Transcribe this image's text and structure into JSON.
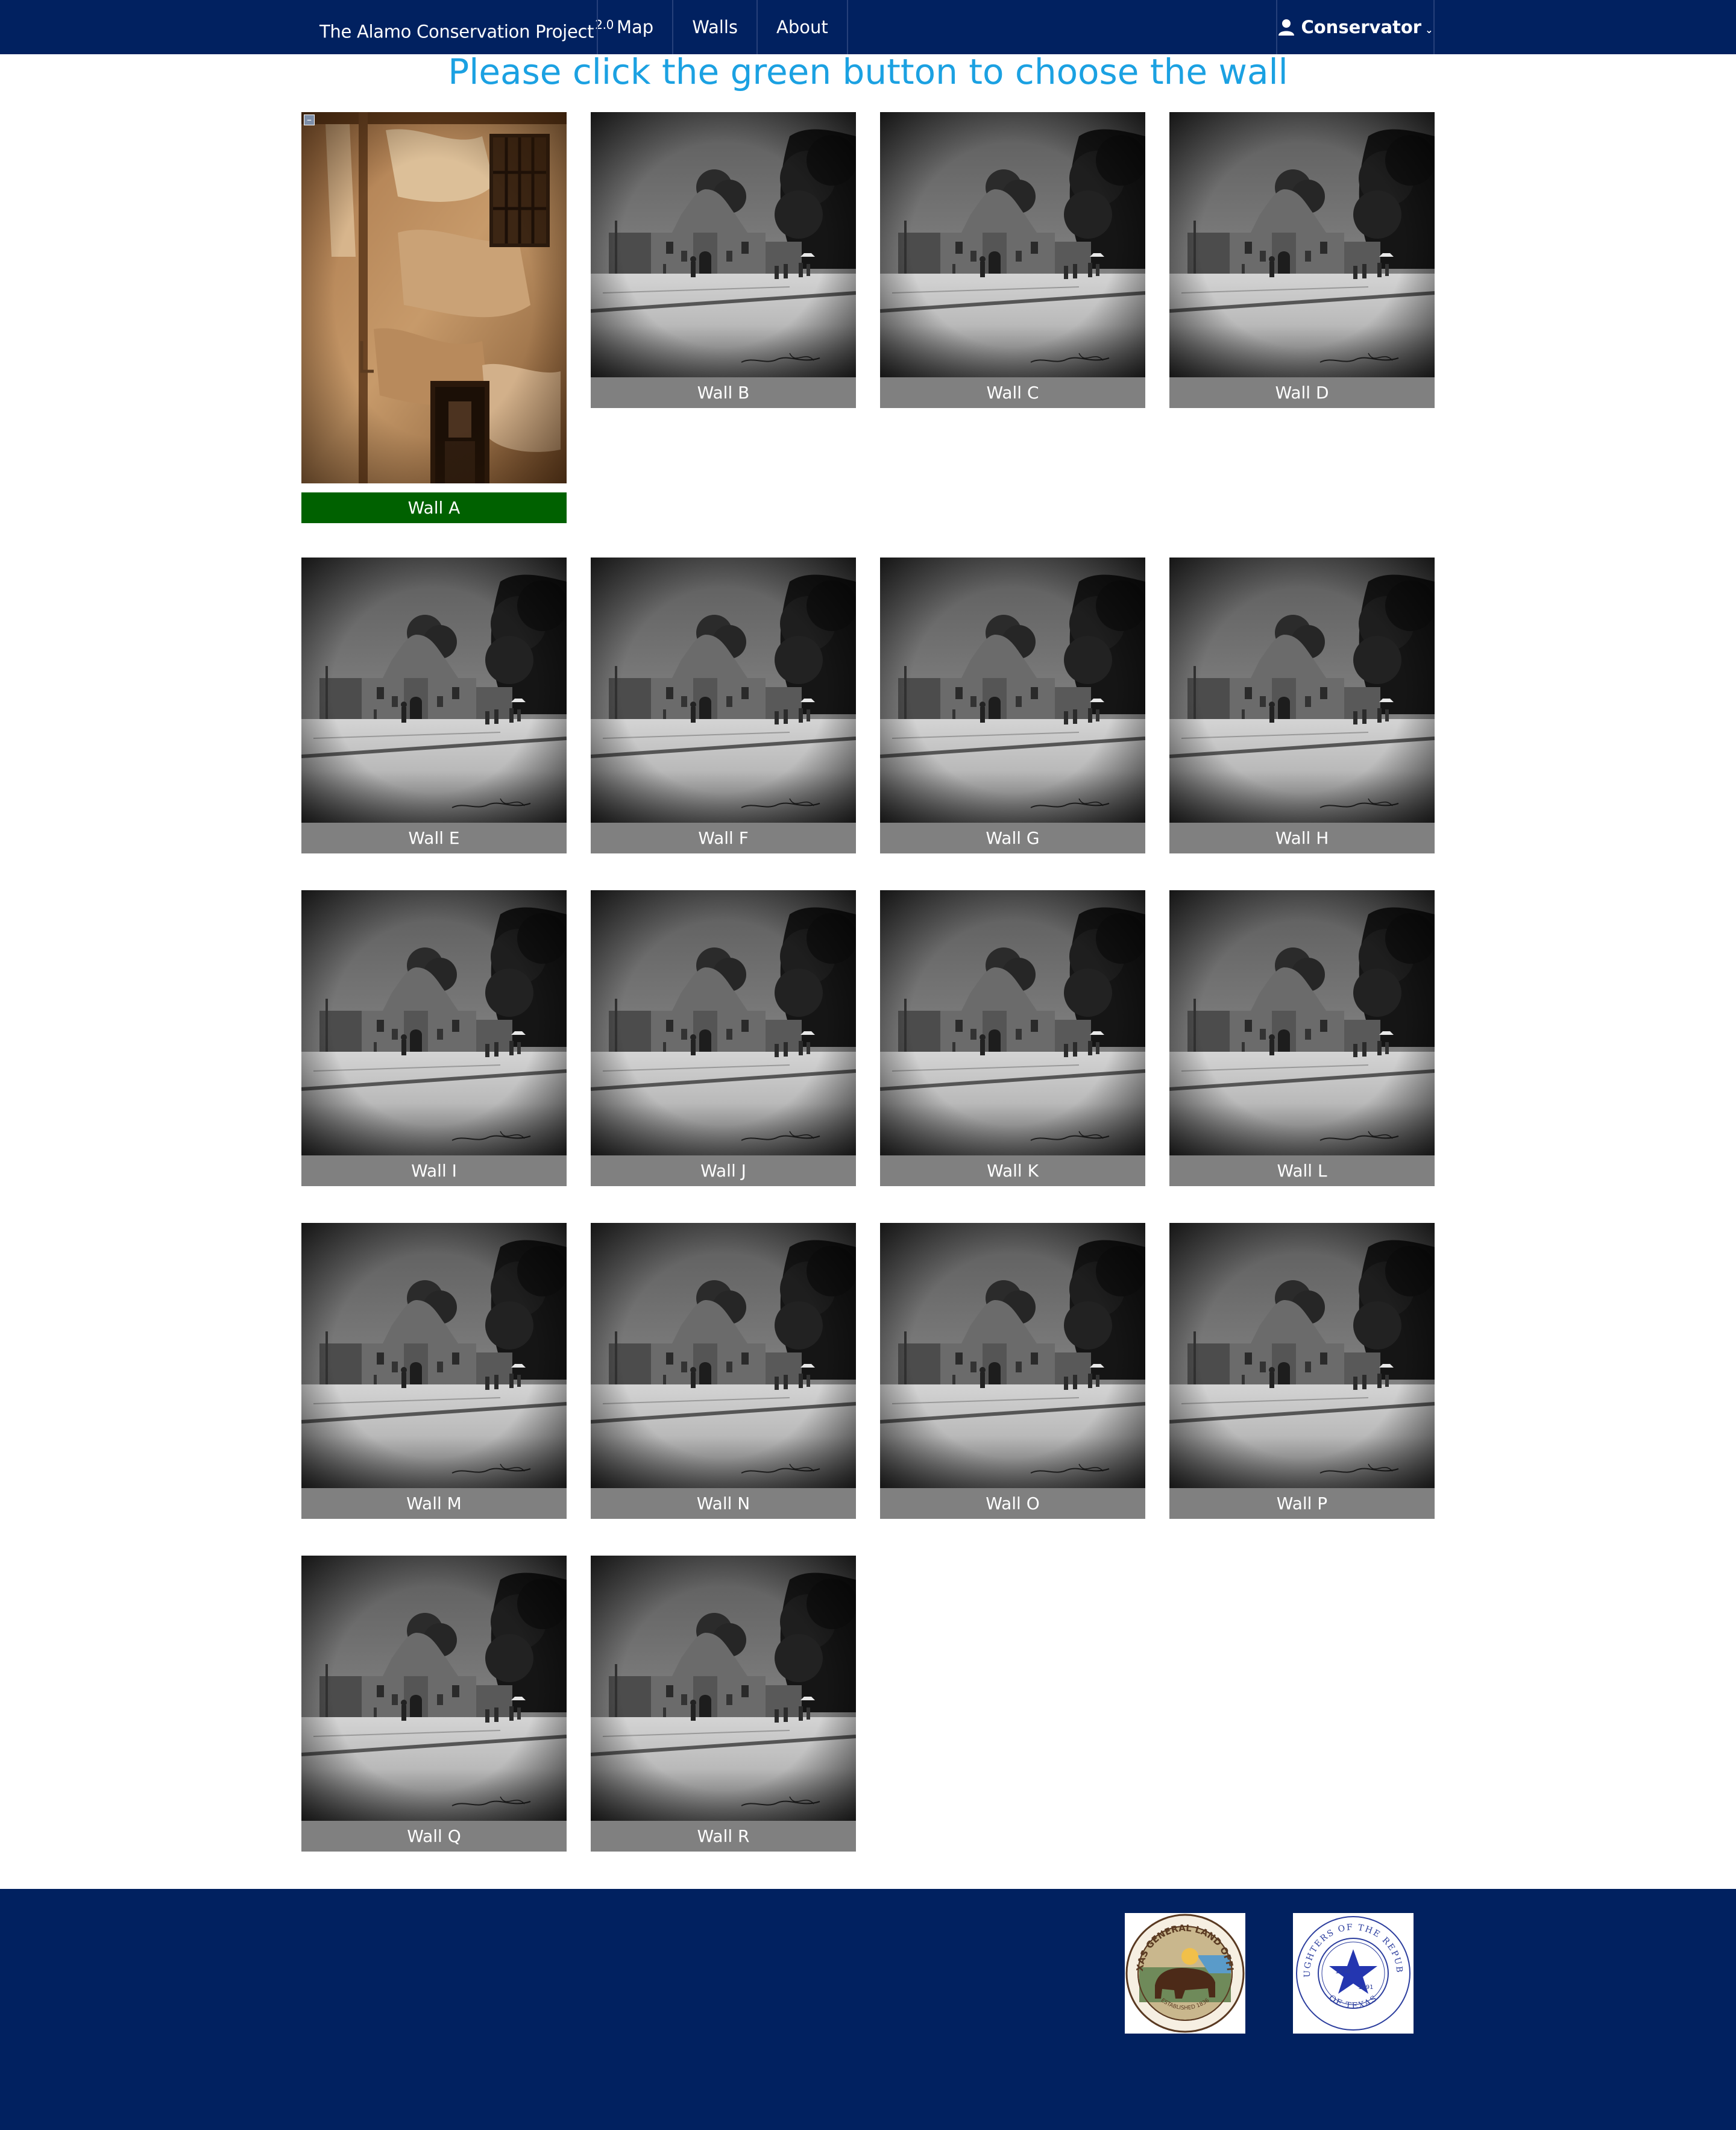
{
  "navbar": {
    "brand": "The Alamo Conservation Project",
    "version": "2.0",
    "links": [
      "Map",
      "Walls",
      "About"
    ],
    "user_label": "Conservator",
    "user_icon": "user-icon",
    "chevron_icon": "chevron-down-icon"
  },
  "heading": "Please click the green button to choose the wall",
  "walls": [
    {
      "label": "Wall A",
      "selected": true
    },
    {
      "label": "Wall B",
      "selected": false
    },
    {
      "label": "Wall C",
      "selected": false
    },
    {
      "label": "Wall D",
      "selected": false
    },
    {
      "label": "Wall E",
      "selected": false
    },
    {
      "label": "Wall F",
      "selected": false
    },
    {
      "label": "Wall G",
      "selected": false
    },
    {
      "label": "Wall H",
      "selected": false
    },
    {
      "label": "Wall I",
      "selected": false
    },
    {
      "label": "Wall J",
      "selected": false
    },
    {
      "label": "Wall K",
      "selected": false
    },
    {
      "label": "Wall L",
      "selected": false
    },
    {
      "label": "Wall M",
      "selected": false
    },
    {
      "label": "Wall N",
      "selected": false
    },
    {
      "label": "Wall O",
      "selected": false
    },
    {
      "label": "Wall P",
      "selected": false
    },
    {
      "label": "Wall Q",
      "selected": false
    },
    {
      "label": "Wall R",
      "selected": false
    }
  ],
  "footer": {
    "logos": [
      {
        "name": "Texas General Land Office seal",
        "text_top": "TEXAS GENERAL LAND OFFICE",
        "text_bottom": "ESTABLISHED 1836"
      },
      {
        "name": "Daughters of the Republic of Texas seal",
        "text_top": "DAUGHTERS OF THE REPUBLIC",
        "text_bottom": "OF TEXAS",
        "years": [
          "1836",
          "1891"
        ]
      }
    ]
  },
  "colors": {
    "navbar": "#012160",
    "heading": "#1ba1e2",
    "selected_button": "#006100",
    "button": "#808080"
  }
}
